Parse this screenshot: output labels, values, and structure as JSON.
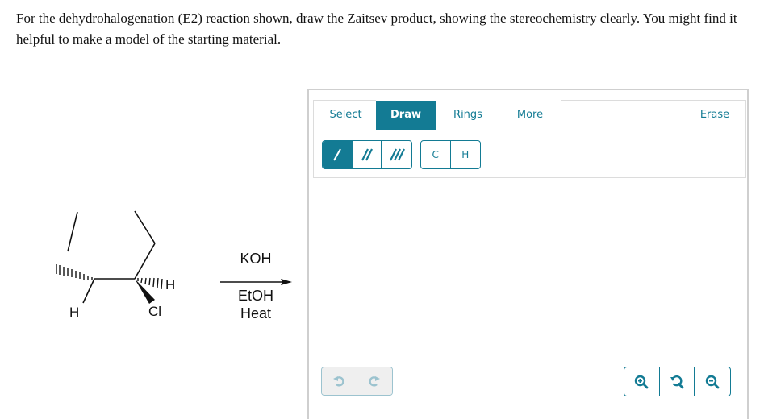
{
  "question": {
    "text": "For the dehydrohalogenation (E2) reaction shown, draw the Zaitsev product, showing the stereochemistry clearly. You might find it helpful to make a model of the starting material."
  },
  "reaction": {
    "reagent_above": "KOH",
    "reagent_below_1": "EtOH",
    "reagent_below_2": "Heat",
    "atoms": {
      "h_left": "H",
      "h_right": "H",
      "cl": "Cl"
    }
  },
  "editor": {
    "tabs": [
      {
        "label": "Select",
        "active": false
      },
      {
        "label": "Draw",
        "active": true
      },
      {
        "label": "Rings",
        "active": false
      },
      {
        "label": "More",
        "active": false
      }
    ],
    "erase_label": "Erase",
    "bond_tools": [
      {
        "name": "single-bond",
        "active": true
      },
      {
        "name": "double-bond",
        "active": false
      },
      {
        "name": "triple-bond",
        "active": false
      }
    ],
    "atom_tools": [
      "C",
      "H"
    ],
    "history": [
      "undo",
      "redo"
    ],
    "zoom_tools": [
      "zoom-in",
      "reset-zoom",
      "zoom-out"
    ],
    "accent_color": "#137b94"
  }
}
